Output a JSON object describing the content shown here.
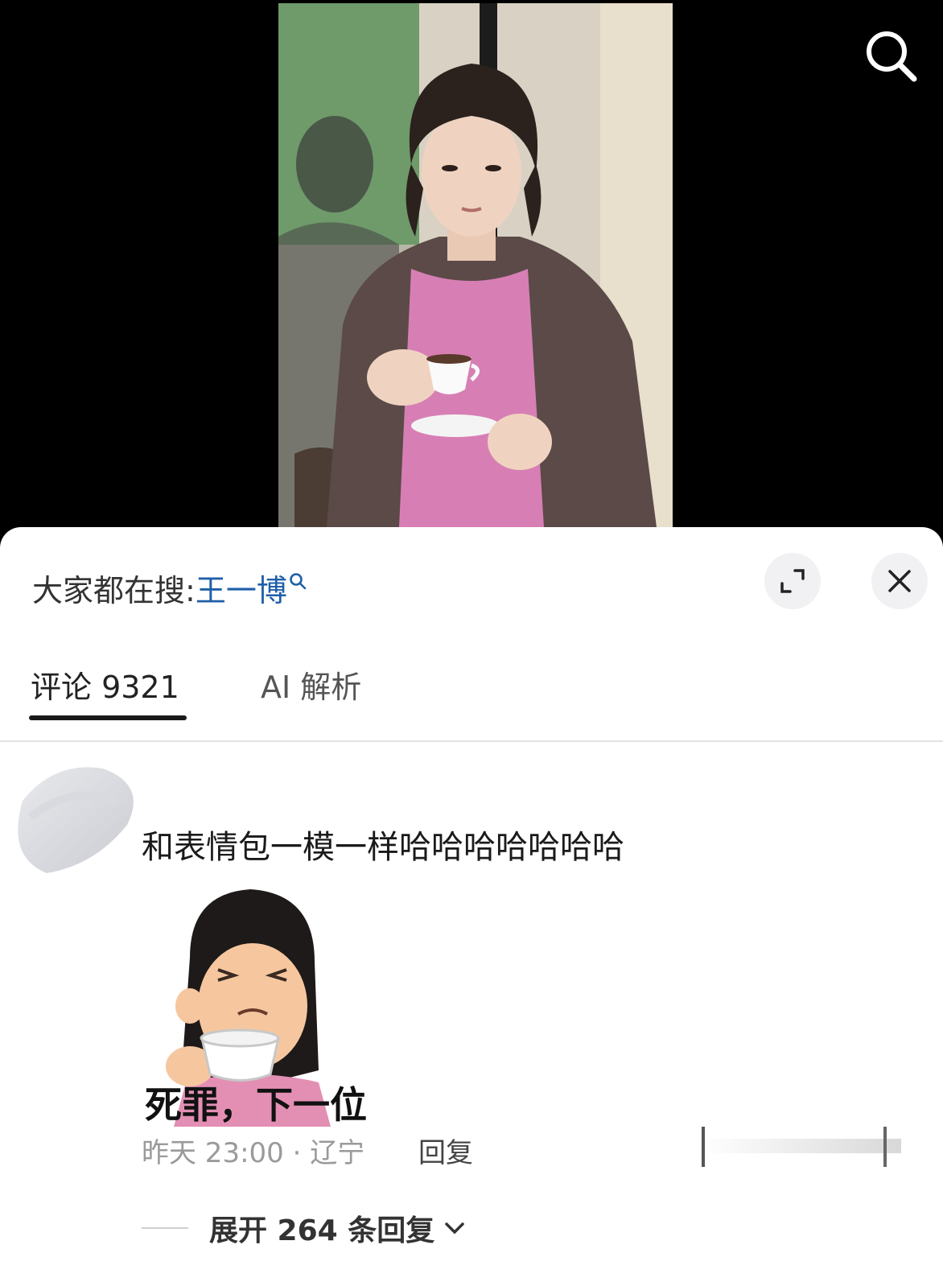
{
  "header": {
    "search_icon": "search-icon"
  },
  "trending": {
    "prefix": "大家都在搜:",
    "keyword": "王一博",
    "keyword_color": "#1f5fa8"
  },
  "sheet_controls": {
    "expand_icon": "expand-icon",
    "close_icon": "close-icon"
  },
  "tabs": [
    {
      "label": "评论 9321",
      "active": true
    },
    {
      "label": "AI 解析",
      "active": false
    }
  ],
  "comment": {
    "text": "和表情包一模一样哈哈哈哈哈哈哈",
    "sticker_caption": "死罪，下一位",
    "time_location": "昨天 23:00 · 辽宁",
    "reply_label": "回复",
    "expand_replies": "展开 264 条回复"
  }
}
